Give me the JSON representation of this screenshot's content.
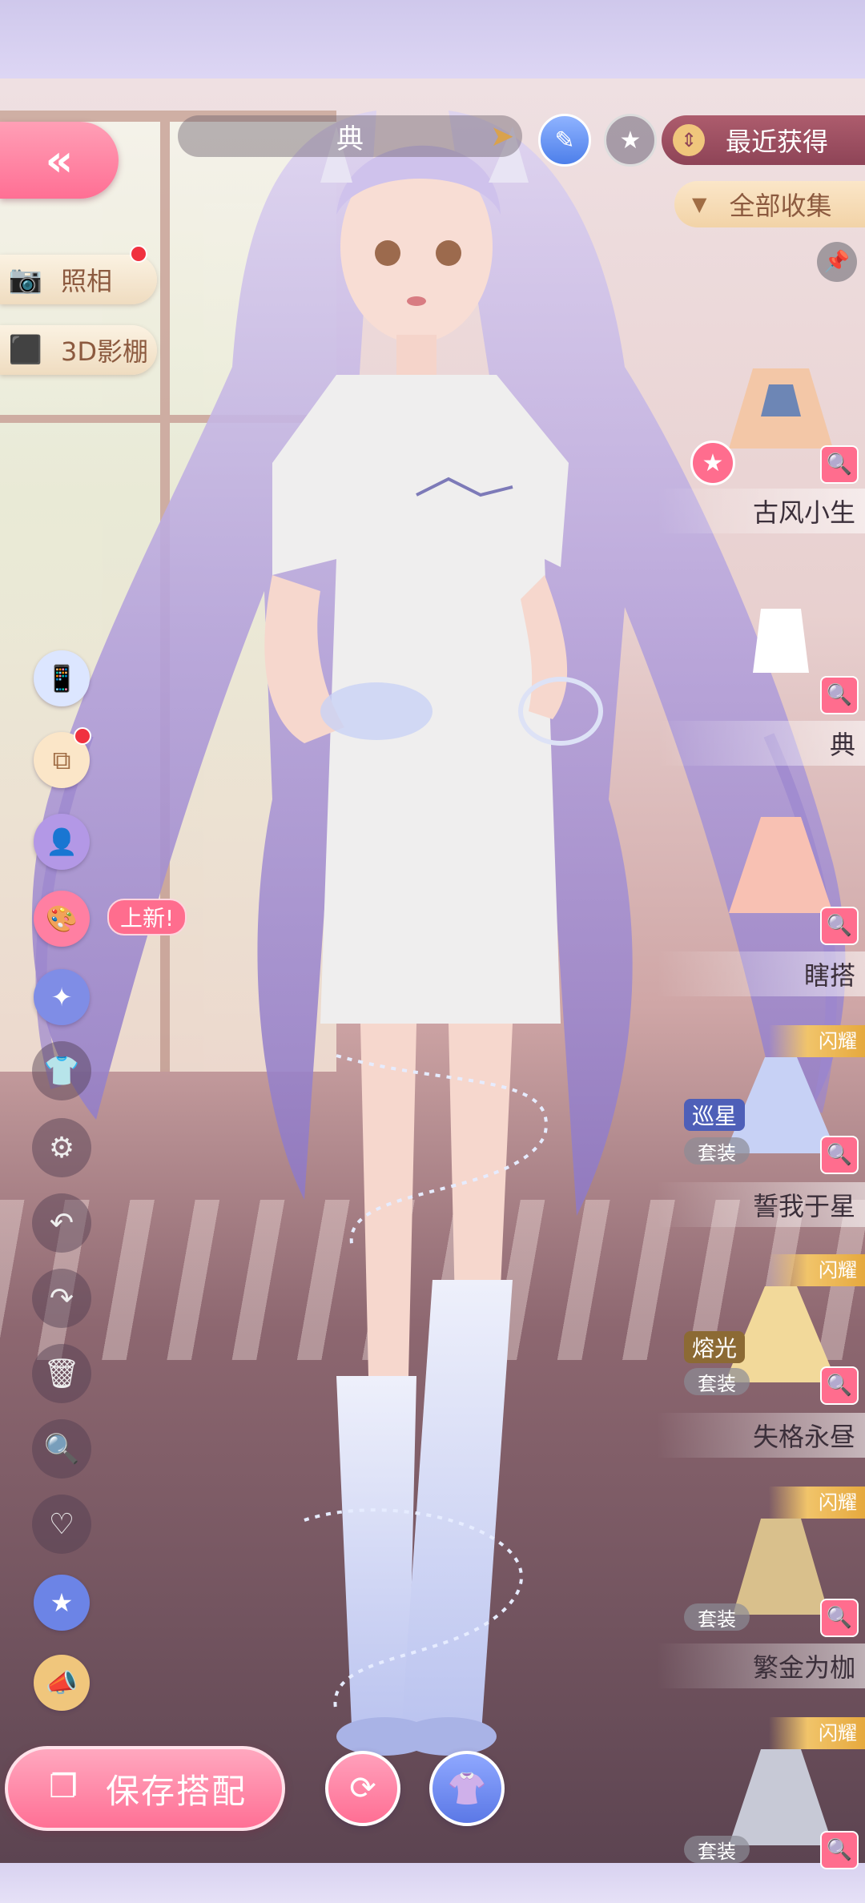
{
  "top_bar": {
    "back_icon": "«",
    "category": "典",
    "sort_label": "最近获得",
    "filter_label": "全部收集"
  },
  "left_panel": {
    "photo_label": "照相",
    "studio_label": "3D影棚",
    "new_tag": "上新!"
  },
  "items": [
    {
      "name": "古风小生",
      "favorite": true
    },
    {
      "name": "典"
    },
    {
      "name": "瞎搭"
    },
    {
      "name": "誓我于星",
      "badge": "巡星",
      "suit": "套装",
      "ribbon": "闪耀"
    },
    {
      "name": "失格永昼",
      "badge": "熔光",
      "suit": "套装",
      "ribbon": "闪耀"
    },
    {
      "name": "繁金为枷",
      "suit": "套装",
      "ribbon": "闪耀"
    },
    {
      "suit": "套装",
      "ribbon": "闪耀"
    }
  ],
  "bottom": {
    "save_label": "保存搭配"
  },
  "colors": {
    "accent_pink": "#ff6d8e",
    "gold": "#f0c67c",
    "hair_lavender": "#b9a6dd"
  }
}
